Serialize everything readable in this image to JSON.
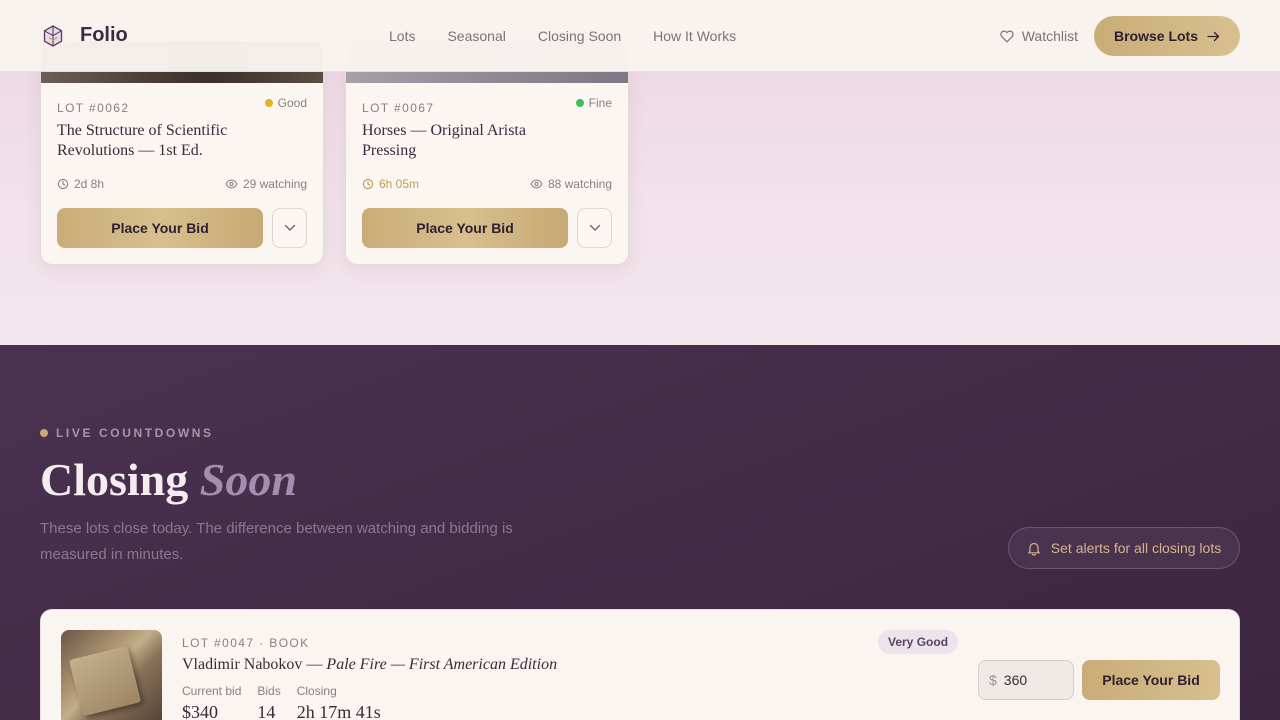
{
  "header": {
    "brand": "Folio",
    "nav": [
      "Lots",
      "Seasonal",
      "Closing Soon",
      "How It Works"
    ],
    "watchlist_label": "Watchlist",
    "browse_label": "Browse Lots"
  },
  "lot_cards": [
    {
      "lot": "LOT #0062",
      "condition": "Good",
      "condition_color": "#e2b22a",
      "title": "The Structure of Scientific Revolutions — 1st Ed.",
      "time_left": "2d 8h",
      "watching": "29 watching",
      "bid_label": "Place Your Bid"
    },
    {
      "lot": "LOT #0067",
      "condition": "Fine",
      "condition_color": "#3cbf5a",
      "title": "Horses — Original Arista Pressing",
      "time_left": "6h 05m",
      "watching": "88 watching",
      "bid_label": "Place Your Bid"
    }
  ],
  "closing_section": {
    "eyebrow": "LIVE COUNTDOWNS",
    "title_main": "Closing",
    "title_accent": "Soon",
    "description": "These lots close today. The difference between watching and bidding is measured in minutes.",
    "alert_label": "Set alerts for all closing lots",
    "featured": {
      "lot": "LOT #0047 · BOOK",
      "author": "Vladimir Nabokov — ",
      "work": "Pale Fire — First American Edition",
      "condition": "Very Good",
      "current_bid_label": "Current bid",
      "current_bid": "$340",
      "bids_label": "Bids",
      "bids": "14",
      "closing_label": "Closing",
      "closing": "2h 17m 41s",
      "currency": "$",
      "bid_value": "360",
      "bid_label": "Place Your Bid"
    }
  },
  "colors": {
    "accent_gold": "#c9ad78",
    "dark_plum": "#452d4a"
  }
}
